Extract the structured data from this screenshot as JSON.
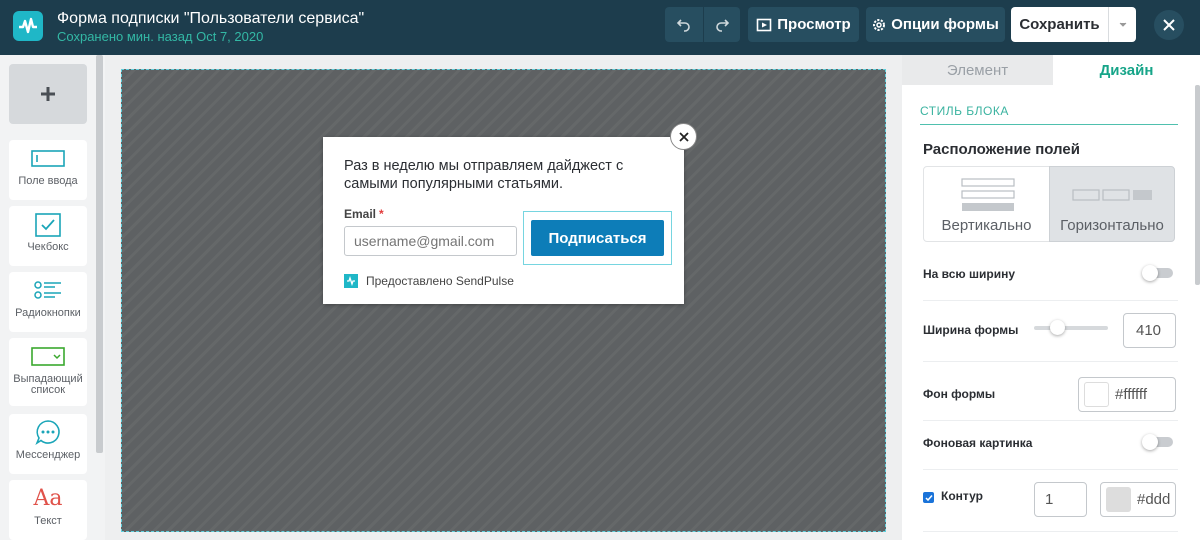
{
  "header": {
    "title": "Форма подписки \"Пользователи сервиса\"",
    "saved_status": "Сохранено мин. назад Oct 7, 2020",
    "preview_label": "Просмотр",
    "options_label": "Опции формы",
    "save_label": "Сохранить"
  },
  "left_panel": {
    "tools": [
      {
        "label": "Поле ввода",
        "icon": "input-field-icon"
      },
      {
        "label": "Чекбокс",
        "icon": "checkbox-icon"
      },
      {
        "label": "Радиокнопки",
        "icon": "radio-buttons-icon"
      },
      {
        "label": "Выпадающий список",
        "icon": "dropdown-icon"
      },
      {
        "label": "Мессенджер",
        "icon": "messenger-icon"
      },
      {
        "label": "Текст",
        "icon": "text-icon"
      }
    ]
  },
  "form": {
    "text": "Раз в неделю мы отправляем дайджест с самыми популярными статьями.",
    "email_label": "Email",
    "required_mark": "*",
    "email_placeholder": "username@gmail.com",
    "button_label": "Подписаться",
    "powered_by": "Предоставлено SendPulse"
  },
  "right_panel": {
    "tabs": [
      {
        "label": "Элемент",
        "active": false
      },
      {
        "label": "Дизайн",
        "active": true
      }
    ],
    "section_title": "СТИЛЬ БЛОКА",
    "layout_heading": "Расположение полей",
    "layout_options": [
      {
        "label": "Вертикально",
        "selected": false
      },
      {
        "label": "Горизонтально",
        "selected": true
      }
    ],
    "full_width_label": "На всю ширину",
    "full_width_on": false,
    "form_width_label": "Ширина формы",
    "form_width_value": "410",
    "form_bg_label": "Фон формы",
    "form_bg_value": "#ffffff",
    "bg_image_label": "Фоновая картинка",
    "bg_image_on": false,
    "border_label": "Контур",
    "border_checked": true,
    "border_width_value": "1",
    "border_color_value": "#ddd"
  },
  "colors": {
    "header_bg": "#1d3d4d",
    "accent": "#1fb7c7",
    "design_tab": "#17a589",
    "subscribe_button": "#0d7db8"
  }
}
